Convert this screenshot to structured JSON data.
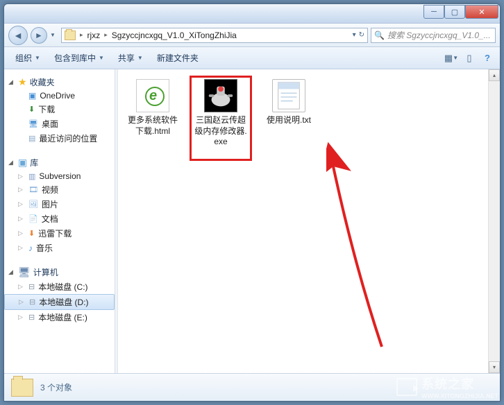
{
  "breadcrumb": {
    "crumb1": "rjxz",
    "crumb2": "Sgzyccjncxgq_V1.0_XiTongZhiJia"
  },
  "search": {
    "placeholder": "搜索 Sgzyccjncxgq_V1.0_..."
  },
  "toolbar": {
    "organize": "组织",
    "include": "包含到库中",
    "share": "共享",
    "newfolder": "新建文件夹"
  },
  "sidebar": {
    "favorites": {
      "label": "收藏夹",
      "items": [
        "OneDrive",
        "下载",
        "桌面",
        "最近访问的位置"
      ]
    },
    "libraries": {
      "label": "库",
      "items": [
        "Subversion",
        "视频",
        "图片",
        "文档",
        "迅雷下载",
        "音乐"
      ]
    },
    "computer": {
      "label": "计算机",
      "items": [
        "本地磁盘 (C:)",
        "本地磁盘 (D:)",
        "本地磁盘 (E:)"
      ]
    }
  },
  "files": [
    {
      "name": "更多系统软件下载.html"
    },
    {
      "name": "三国赵云传超级内存修改器.exe"
    },
    {
      "name": "使用说明.txt"
    }
  ],
  "status": {
    "count": "3 个对象"
  },
  "watermark": {
    "text": "系统之家",
    "url": "WWW.XITONGZHIJIA.NET"
  }
}
